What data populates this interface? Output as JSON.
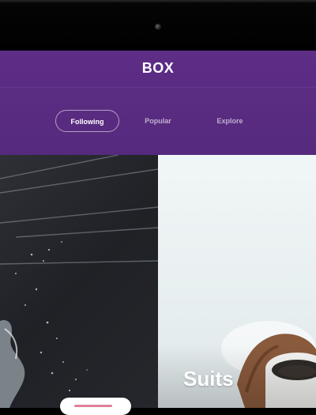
{
  "app": {
    "brand": "BOX"
  },
  "tabs": [
    {
      "label": "Following",
      "active": true
    },
    {
      "label": "Popular",
      "active": false
    },
    {
      "label": "Explore",
      "active": false
    }
  ],
  "cards": [
    {
      "title": ""
    },
    {
      "title": "Suits"
    }
  ],
  "colors": {
    "header": "#5a2c82",
    "tab_active_border": "#ffffff"
  }
}
